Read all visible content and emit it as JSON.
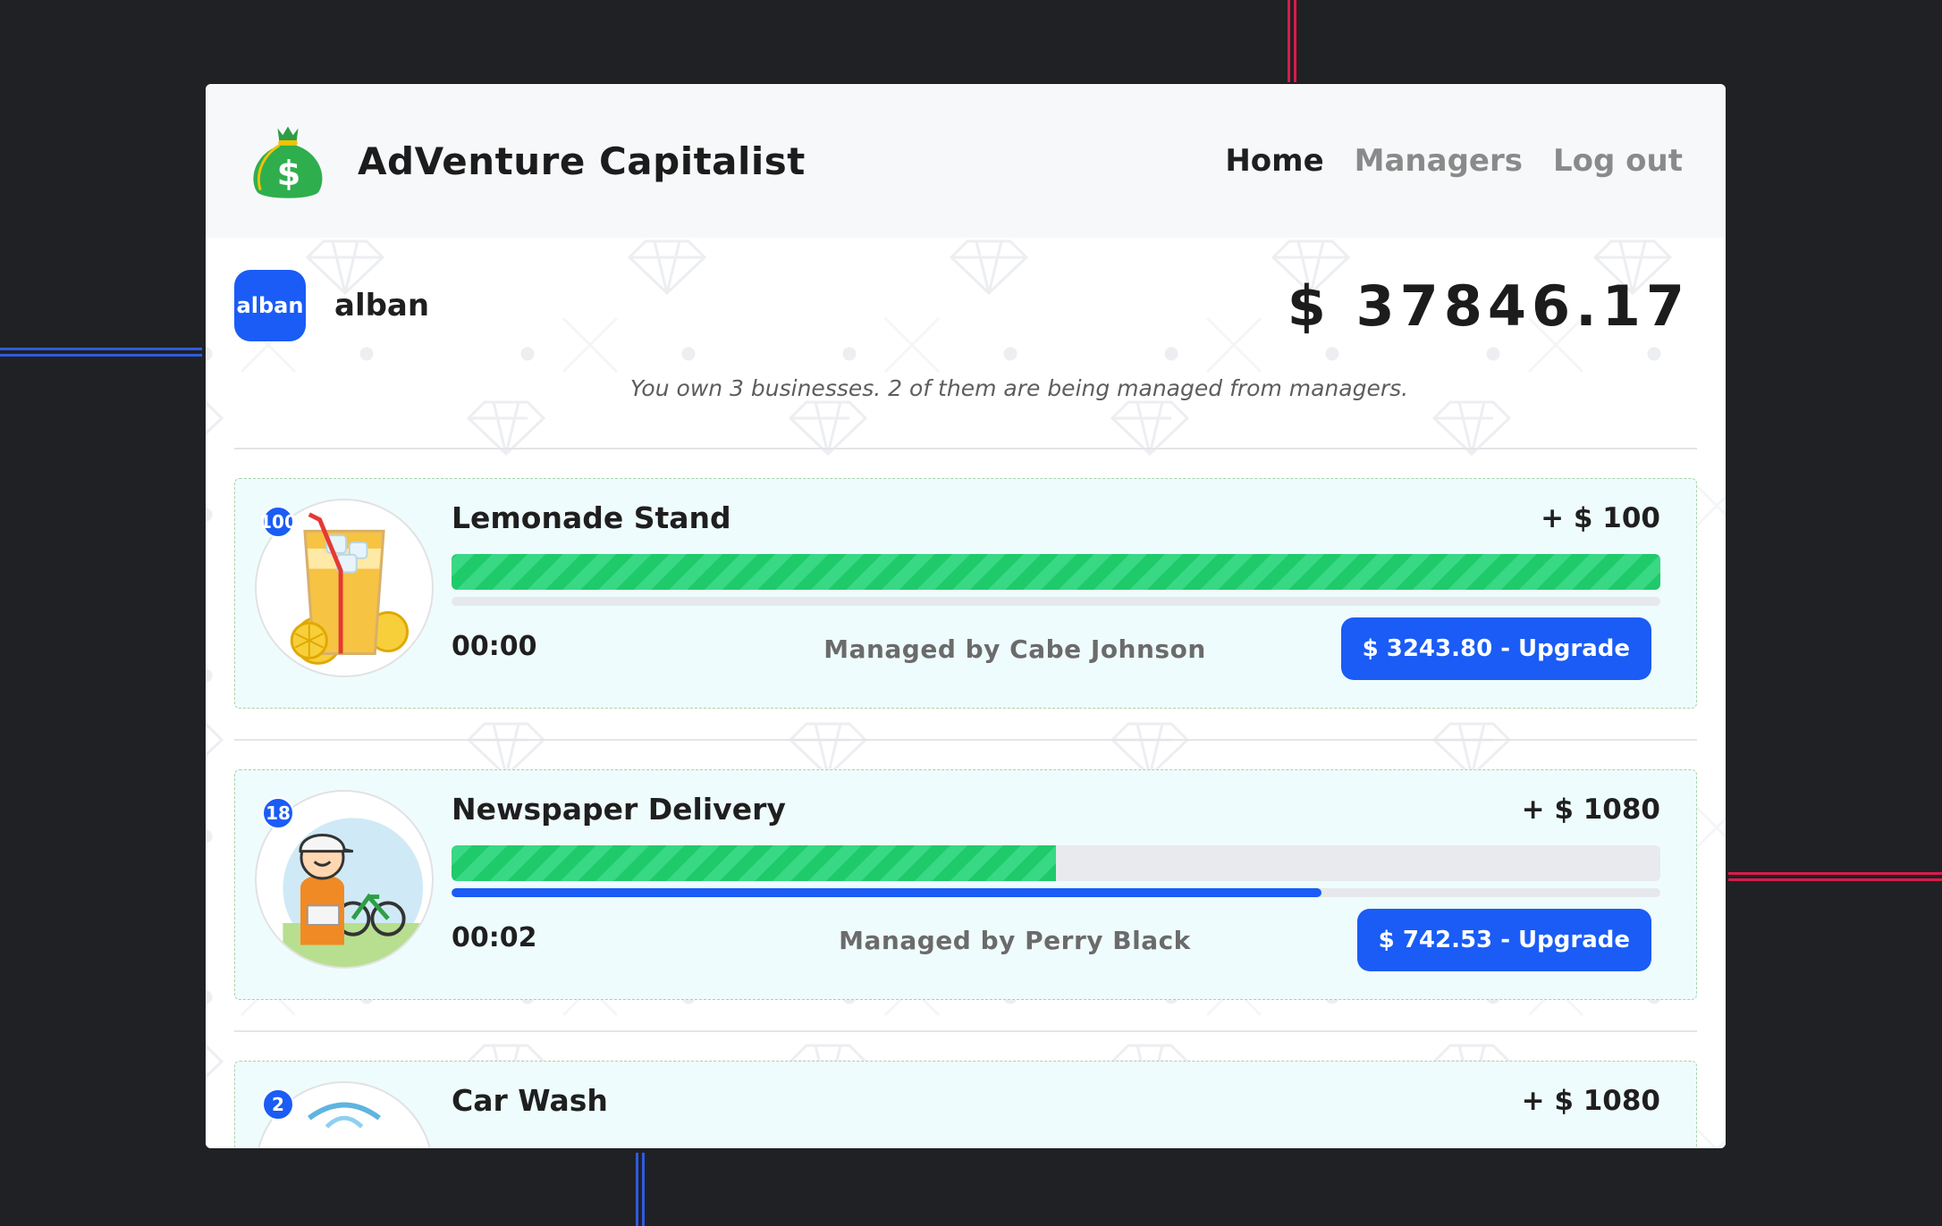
{
  "app": {
    "title": "AdVenture Capitalist",
    "logo_icon": "money-bag-icon"
  },
  "nav": {
    "items": [
      {
        "label": "Home",
        "active": true
      },
      {
        "label": "Managers",
        "active": false
      },
      {
        "label": "Log out",
        "active": false
      }
    ]
  },
  "user": {
    "avatar_text": "alban",
    "name": "alban",
    "balance": "$ 37846.17"
  },
  "summary": "You own 3 businesses. 2 of them are being managed from managers.",
  "businesses": [
    {
      "count": "100",
      "name": "Lemonade Stand",
      "income": "+ $ 100",
      "progress": 1.0,
      "manager_progress": 0.0,
      "timer": "00:00",
      "manager": "Managed by Cabe Johnson",
      "upgrade_label": "$ 3243.80 - Upgrade",
      "icon": "lemonade-icon"
    },
    {
      "count": "18",
      "name": "Newspaper Delivery",
      "income": "+ $ 1080",
      "progress": 0.5,
      "manager_progress": 0.72,
      "timer": "00:02",
      "manager": "Managed by Perry Black",
      "upgrade_label": "$ 742.53 - Upgrade",
      "icon": "newspaper-boy-icon"
    },
    {
      "count": "2",
      "name": "Car Wash",
      "income": "+ $ 1080",
      "icon": "car-wash-icon"
    }
  ],
  "colors": {
    "accent": "#1a5cf5",
    "progress_green": "#1fca6a",
    "card_bg": "#effcfd"
  }
}
